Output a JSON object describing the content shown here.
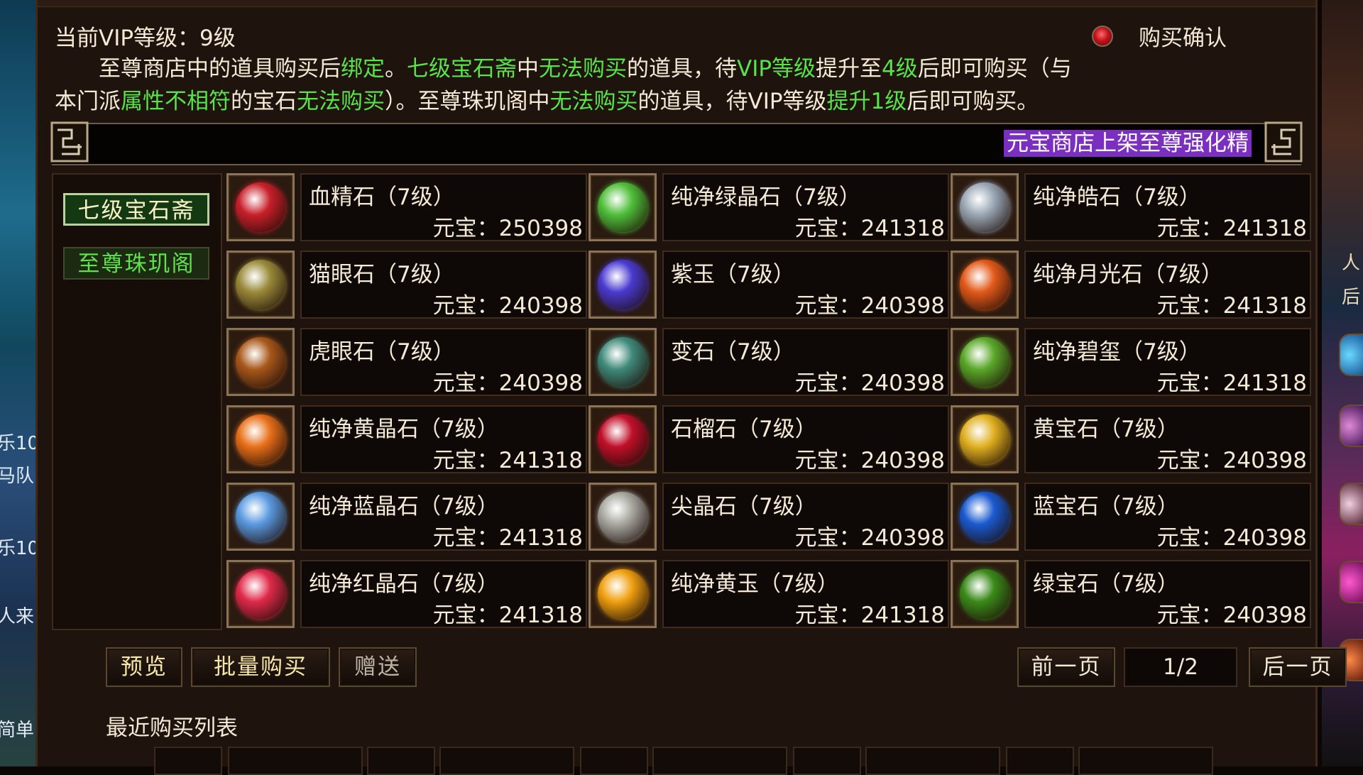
{
  "left_side": {
    "lines": [
      "乐10",
      "马队",
      "乐10",
      "人来",
      "简单"
    ]
  },
  "right_side": {
    "lines": [
      "人",
      "后"
    ]
  },
  "header": {
    "vip_level": "当前VIP等级：9级",
    "confirm_label": "购买确认"
  },
  "notice": {
    "p1_a": "至尊商店中的道具购买后",
    "p1_b": "绑定",
    "p1_c": "。",
    "p1_d": "七级宝石斋",
    "p1_e": "中",
    "p1_f": "无法购买",
    "p1_g": "的道具，待",
    "p1_h": "VIP等级",
    "p1_i": "提升至",
    "p1_j": "4级",
    "p1_k": "后即可购买（与",
    "p2_a": "本门派",
    "p2_b": "属性不相符",
    "p2_c": "的宝石",
    "p2_d": "无法购买",
    "p2_e": "）。至尊珠玑阁中",
    "p2_f": "无法购买",
    "p2_g": "的道具，待VIP等级",
    "p2_h": "提升1级",
    "p2_i": "后即可购买。"
  },
  "marquee": {
    "text": "元宝商店上架至尊强化精"
  },
  "categories": [
    {
      "label": "七级宝石斋"
    },
    {
      "label": "至尊珠玑阁"
    }
  ],
  "items": [
    {
      "name": "血精石（7级）",
      "price": "元宝：250398",
      "icon": "blood-stone-icon",
      "color": "#c8202a"
    },
    {
      "name": "纯净绿晶石（7级）",
      "price": "元宝：241318",
      "icon": "green-crystal-icon",
      "color": "#4fbf3a"
    },
    {
      "name": "纯净皓石（7级）",
      "price": "元宝：241318",
      "icon": "white-stone-icon",
      "color": "#9aa7b5"
    },
    {
      "name": "猫眼石（7级）",
      "price": "元宝：240398",
      "icon": "cat-eye-icon",
      "color": "#9a8a3a"
    },
    {
      "name": "紫玉（7级）",
      "price": "元宝：240398",
      "icon": "purple-jade-icon",
      "color": "#4a3ad0"
    },
    {
      "name": "纯净月光石（7级）",
      "price": "元宝：241318",
      "icon": "moonstone-icon",
      "color": "#e25a1a"
    },
    {
      "name": "虎眼石（7级）",
      "price": "元宝：240398",
      "icon": "tiger-eye-icon",
      "color": "#a8581a"
    },
    {
      "name": "变石（7级）",
      "price": "元宝：240398",
      "icon": "alexandrite-icon",
      "color": "#3f8a7a"
    },
    {
      "name": "纯净碧玺（7级）",
      "price": "元宝：241318",
      "icon": "tourmaline-icon",
      "color": "#5aa82a"
    },
    {
      "name": "纯净黄晶石（7级）",
      "price": "元宝：241318",
      "icon": "yellow-crystal-icon",
      "color": "#e8701a"
    },
    {
      "name": "石榴石（7级）",
      "price": "元宝：240398",
      "icon": "garnet-icon",
      "color": "#c0102a"
    },
    {
      "name": "黄宝石（7级）",
      "price": "元宝：240398",
      "icon": "topaz-icon",
      "color": "#e0b020"
    },
    {
      "name": "纯净蓝晶石（7级）",
      "price": "元宝：241318",
      "icon": "blue-crystal-icon",
      "color": "#5a9ae0"
    },
    {
      "name": "尖晶石（7级）",
      "price": "元宝：240398",
      "icon": "spinel-icon",
      "color": "#a8a8a0"
    },
    {
      "name": "蓝宝石（7级）",
      "price": "元宝：240398",
      "icon": "sapphire-icon",
      "color": "#1a5ad0"
    },
    {
      "name": "纯净红晶石（7级）",
      "price": "元宝：241318",
      "icon": "red-crystal-icon",
      "color": "#e02a4a"
    },
    {
      "name": "纯净黄玉（7级）",
      "price": "元宝：241318",
      "icon": "yellow-jade-icon",
      "color": "#f0a010"
    },
    {
      "name": "绿宝石（7级）",
      "price": "元宝：240398",
      "icon": "emerald-icon",
      "color": "#3a8a1a"
    }
  ],
  "buttons": {
    "preview": "预览",
    "bulk_buy": "批量购买",
    "gift": "赠送",
    "prev_page": "前一页",
    "page": "1/2",
    "next_page": "后一页"
  },
  "recent": {
    "label": "最近购买列表"
  }
}
